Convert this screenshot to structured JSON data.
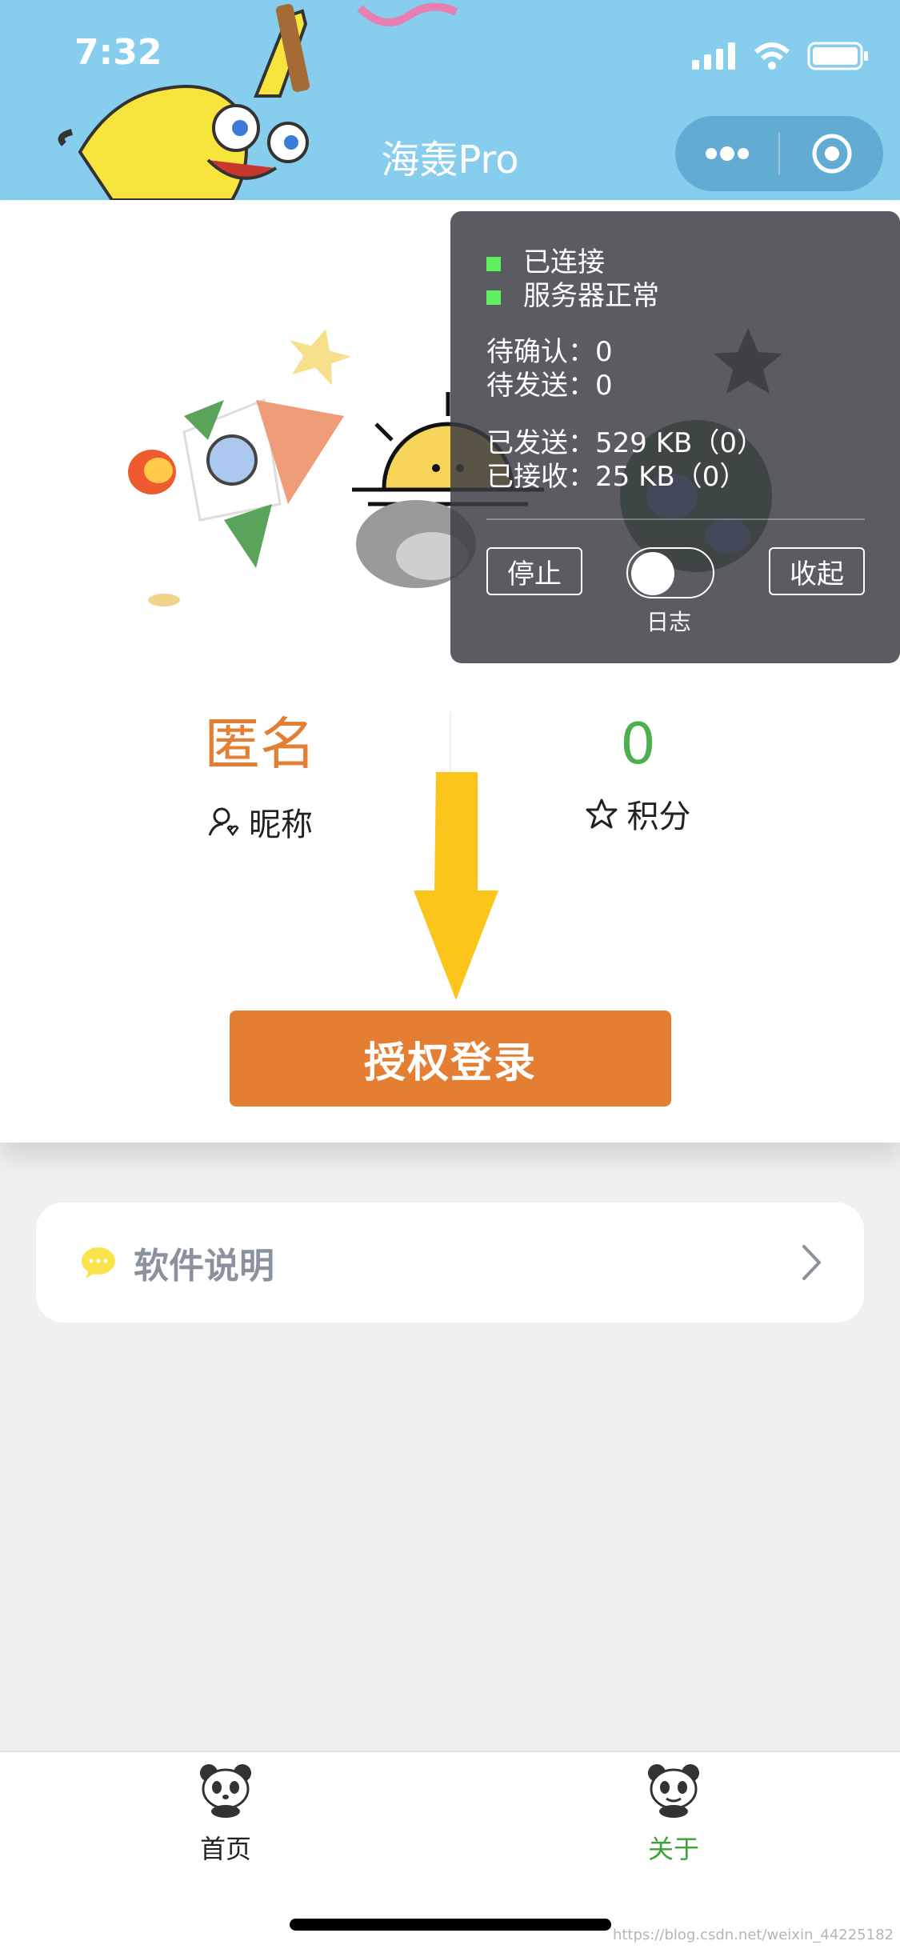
{
  "status_bar": {
    "time": "7:32"
  },
  "header": {
    "title": "海轰Pro"
  },
  "debug_panel": {
    "connected": "已连接",
    "server_ok": "服务器正常",
    "pending_confirm": "待确认：0",
    "pending_send": "待发送：0",
    "sent": "已发送：529 KB（0）",
    "received": "已接收：25 KB（0）",
    "stop_label": "停止",
    "log_label": "日志",
    "collapse_label": "收起"
  },
  "profile": {
    "nickname_value": "匿名",
    "nickname_label": "昵称",
    "points_value": "0",
    "points_label": "积分"
  },
  "login_button": "授权登录",
  "info_card": {
    "label": "软件说明"
  },
  "tabbar": {
    "items": [
      {
        "label": "首页"
      },
      {
        "label": "关于"
      }
    ]
  },
  "watermark": "https://blog.csdn.net/weixin_44225182",
  "colors": {
    "header_bg": "#86cdee",
    "accent_orange": "#e47e32",
    "points_green": "#4caf50",
    "active_tab": "#3aa33a",
    "arrow_yellow": "#fbc51c"
  }
}
